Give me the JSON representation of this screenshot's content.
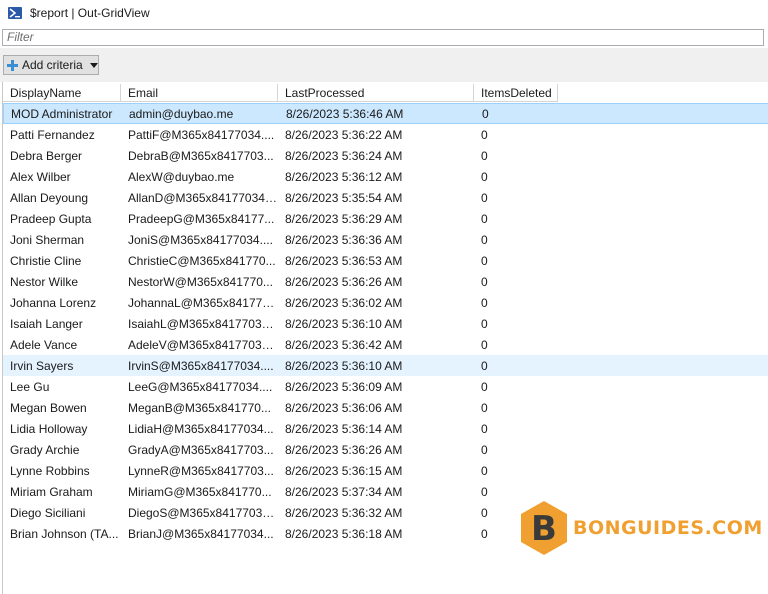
{
  "window": {
    "title": "$report | Out-GridView"
  },
  "filter": {
    "placeholder": "Filter"
  },
  "toolbar": {
    "add_criteria_label": "Add criteria"
  },
  "columns": [
    "DisplayName",
    "Email",
    "LastProcessed",
    "ItemsDeleted"
  ],
  "rows": [
    {
      "name": "MOD Administrator",
      "email": "admin@duybao.me",
      "last": "8/26/2023 5:36:46 AM",
      "deleted": "0"
    },
    {
      "name": "Patti Fernandez",
      "email": "PattiF@M365x84177034....",
      "last": "8/26/2023 5:36:22 AM",
      "deleted": "0"
    },
    {
      "name": "Debra Berger",
      "email": "DebraB@M365x8417703...",
      "last": "8/26/2023 5:36:24 AM",
      "deleted": "0"
    },
    {
      "name": "Alex Wilber",
      "email": "AlexW@duybao.me",
      "last": "8/26/2023 5:36:12 AM",
      "deleted": "0"
    },
    {
      "name": "Allan Deyoung",
      "email": "AllanD@M365x84177034....",
      "last": "8/26/2023 5:35:54 AM",
      "deleted": "0"
    },
    {
      "name": "Pradeep Gupta",
      "email": "PradeepG@M365x84177...",
      "last": "8/26/2023 5:36:29 AM",
      "deleted": "0"
    },
    {
      "name": "Joni Sherman",
      "email": "JoniS@M365x84177034....",
      "last": "8/26/2023 5:36:36 AM",
      "deleted": "0"
    },
    {
      "name": "Christie Cline",
      "email": "ChristieC@M365x841770...",
      "last": "8/26/2023 5:36:53 AM",
      "deleted": "0"
    },
    {
      "name": "Nestor Wilke",
      "email": "NestorW@M365x841770...",
      "last": "8/26/2023 5:36:26 AM",
      "deleted": "0"
    },
    {
      "name": "Johanna Lorenz",
      "email": "JohannaL@M365x841770...",
      "last": "8/26/2023 5:36:02 AM",
      "deleted": "0"
    },
    {
      "name": "Isaiah Langer",
      "email": "IsaiahL@M365x84177034...",
      "last": "8/26/2023 5:36:10 AM",
      "deleted": "0"
    },
    {
      "name": "Adele Vance",
      "email": "AdeleV@M365x84177034...",
      "last": "8/26/2023 5:36:42 AM",
      "deleted": "0"
    },
    {
      "name": "Irvin Sayers",
      "email": "IrvinS@M365x84177034....",
      "last": "8/26/2023 5:36:10 AM",
      "deleted": "0"
    },
    {
      "name": "Lee Gu",
      "email": "LeeG@M365x84177034....",
      "last": "8/26/2023 5:36:09 AM",
      "deleted": "0"
    },
    {
      "name": "Megan Bowen",
      "email": "MeganB@M365x841770...",
      "last": "8/26/2023 5:36:06 AM",
      "deleted": "0"
    },
    {
      "name": "Lidia Holloway",
      "email": "LidiaH@M365x84177034...",
      "last": "8/26/2023 5:36:14 AM",
      "deleted": "0"
    },
    {
      "name": "Grady Archie",
      "email": "GradyA@M365x8417703...",
      "last": "8/26/2023 5:36:26 AM",
      "deleted": "0"
    },
    {
      "name": "Lynne Robbins",
      "email": "LynneR@M365x8417703...",
      "last": "8/26/2023 5:36:15 AM",
      "deleted": "0"
    },
    {
      "name": "Miriam Graham",
      "email": "MiriamG@M365x841770...",
      "last": "8/26/2023 5:37:34 AM",
      "deleted": "0"
    },
    {
      "name": "Diego Siciliani",
      "email": "DiegoS@M365x84177034...",
      "last": "8/26/2023 5:36:32 AM",
      "deleted": "0"
    },
    {
      "name": "Brian Johnson (TA...",
      "email": "BrianJ@M365x84177034...",
      "last": "8/26/2023 5:36:18 AM",
      "deleted": "0"
    }
  ],
  "selected_row": 0,
  "hover_row": 12,
  "watermark": {
    "text": "BONGUIDES.COM",
    "letter": "B"
  },
  "colors": {
    "selection": "#cce8ff",
    "hover": "#e5f3ff",
    "accent": "#3a8fd4",
    "watermark": "#f0a030"
  }
}
